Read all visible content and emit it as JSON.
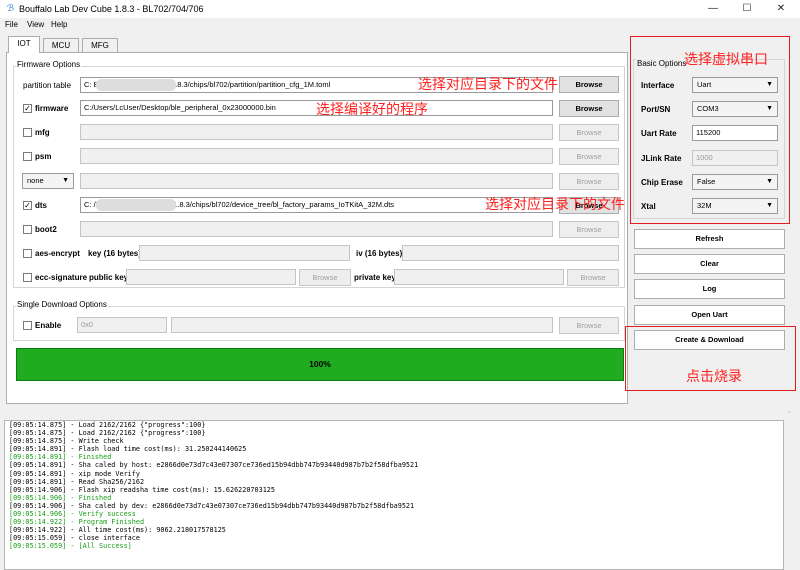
{
  "window": {
    "title": "Bouffalo Lab Dev Cube 1.8.3 - BL702/704/706",
    "controls": [
      "—",
      "☐",
      "✕"
    ]
  },
  "menu": [
    "File",
    "View",
    "Help"
  ],
  "tabs": [
    "IOT",
    "MCU",
    "MFG"
  ],
  "firmware": {
    "group_title": "Firmware Options",
    "partition_label": "partition table",
    "partition_value": "C:                                          BouffaloLabDevCube-v1.8.3/chips/bl702/partition/partition_cfg_1M.toml",
    "firmware_label": "firmware",
    "firmware_value": "C:/Users/LcUser/Desktop/ble_peripheral_0x23000000.bin",
    "mfg_label": "mfg",
    "psm_label": "psm",
    "none_select": "none",
    "dts_label": "dts",
    "dts_value": "C:                                          /BouffaloLabDevCube-v1.8.3/chips/bl702/device_tree/bl_factory_params_IoTKitA_32M.dts",
    "boot2_label": "boot2",
    "aes_label": "aes-encrypt",
    "key_label": "key (16 bytes)",
    "iv_label": "iv (16 bytes)",
    "ecc_label": "ecc-signature",
    "pubkey_label": "public key",
    "privkey_label": "private key",
    "browse": "Browse"
  },
  "single": {
    "group_title": "Single Download Options",
    "enable_label": "Enable",
    "addr_value": "0x0",
    "browse": "Browse"
  },
  "progress": {
    "value": 100,
    "text": "100%"
  },
  "basic": {
    "group_title": "Basic Options",
    "interface_label": "Interface",
    "interface_value": "Uart",
    "port_label": "Port/SN",
    "port_value": "COM3",
    "uart_rate_label": "Uart Rate",
    "uart_rate_value": "115200",
    "jlink_rate_label": "JLink Rate",
    "jlink_rate_value": "1000",
    "chip_erase_label": "Chip Erase",
    "chip_erase_value": "False",
    "xtal_label": "Xtal",
    "xtal_value": "32M"
  },
  "buttons": {
    "refresh": "Refresh",
    "clear": "Clear",
    "log": "Log",
    "open_uart": "Open Uart",
    "create_download": "Create & Download"
  },
  "annotations": {
    "select_file_1": "选择对应目录下的文件",
    "select_program": "选择编译好的程序",
    "select_file_2": "选择对应目录下的文件",
    "select_port": "选择虚拟串口",
    "click_burn": "点击烧录"
  },
  "log": [
    {
      "text": "[09:05:14.875] - Load 2162/2162 {\"progress\":100}",
      "green": false
    },
    {
      "text": "[09:05:14.875] - Load 2162/2162 {\"progress\":100}",
      "green": false
    },
    {
      "text": "[09:05:14.875] - Write check",
      "green": false
    },
    {
      "text": "[09:05:14.891] - Flash load time cost(ms): 31.250244140625",
      "green": false
    },
    {
      "text": "[09:05:14.891] - Finished",
      "green": true
    },
    {
      "text": "[09:05:14.891] - Sha caled by host: e2866d0e73d7c43e07307ce736ed15b94dbb747b93440d987b7b2f58dfba9521",
      "green": false
    },
    {
      "text": "[09:05:14.891] - xip mode Verify",
      "green": false
    },
    {
      "text": "[09:05:14.891] - Read Sha256/2162",
      "green": false
    },
    {
      "text": "[09:05:14.906] - Flash xip readsha time cost(ms): 15.626220703125",
      "green": false
    },
    {
      "text": "[09:05:14.906] - Finished",
      "green": true
    },
    {
      "text": "[09:05:14.906] - Sha caled by dev: e2866d0e73d7c43e07307ce736ed15b94dbb747b93440d987b7b2f58dfba9521",
      "green": false
    },
    {
      "text": "[09:05:14.906] - Verify success",
      "green": true
    },
    {
      "text": "[09:05:14.922] - Program Finished",
      "green": true
    },
    {
      "text": "[09:05:14.922] - All time cost(ms): 9062.218017578125",
      "green": false
    },
    {
      "text": "[09:05:15.059] - close interface",
      "green": false
    },
    {
      "text": "[09:05:15.059] - [All Success]",
      "green": true
    }
  ]
}
